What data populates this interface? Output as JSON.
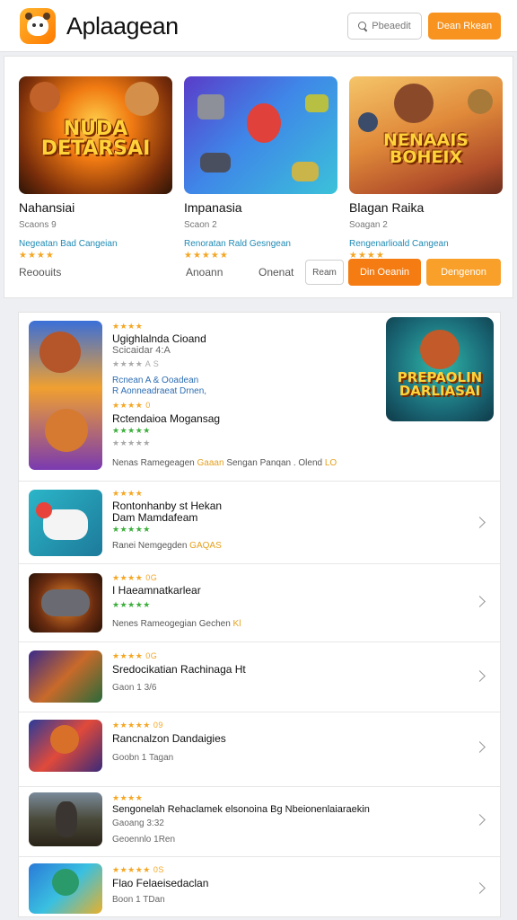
{
  "header": {
    "app_title": "Aplaagean",
    "search_label": "Pbeaedit",
    "signin_label": "Dean Rkean"
  },
  "featured": {
    "cards": [
      {
        "banner": "NUDA DETARSAI",
        "name": "Nahansiai",
        "meta": "Scaons 9",
        "category": "Negeatan Bad Cangeian",
        "stars": "★★★★"
      },
      {
        "banner": "",
        "name": "Impanasia",
        "meta": "Scaon 2",
        "category": "Renoratan Rald Gesngean",
        "stars": "★★★★★"
      },
      {
        "banner": "NENAAIS BOHEIX",
        "name": "Blagan Raika",
        "meta": "Soagan 2",
        "category": "Rengenarlioald Cangean",
        "stars": "★★★★"
      }
    ],
    "links": [
      "Reoouits",
      "Anoann",
      "Onenat"
    ],
    "outline_button": "Ream",
    "orange_button_1": "Din Oeanin",
    "orange_button_2": "Dengenon"
  },
  "list": {
    "first": {
      "stars_top": "★★★★",
      "title": "Ugighlalnda Cioand",
      "sub": "Scicaidar 4:A",
      "graystars": "★★★★ A S",
      "link1": "Rcnean A & Ooadean",
      "link2": "R Aonneadraeat Drnen,",
      "stars2": "★★★★ 0",
      "title2": "Rctendaioa Mogansag",
      "gstars": "★★★★★",
      "graystars2": "★★★★★",
      "meta": "Nenas Ramegeagen",
      "meta_accent": "Gaaan",
      "meta_rest": "Sengan Panqan . Olend",
      "meta_end": "LO",
      "side_banner": "PREPAOLIN DARLIASAI"
    },
    "rows": [
      {
        "stars": "★★★★",
        "title": "Rontonhanby st Hekan",
        "sub": "Dam Mamdafeam",
        "gstars": "★★★★★",
        "meta": "Ranei Nemgegden",
        "accent": "GAQAS"
      },
      {
        "stars": "★★★★ 0G",
        "title": "I Haeamnatkarlear",
        "gstars": "★★★★★",
        "meta": "Nenes Rameogegian Gechen",
        "accent": "Kl"
      },
      {
        "stars": "★★★★ 0G",
        "title": "Sredocikatian Rachinaga Ht",
        "meta": "Gaon 1 3/6",
        "accent": ""
      },
      {
        "stars": "★★★★★ 09",
        "title": "Rancnalzon Dandaigies",
        "meta": "Goobn 1 Tagan",
        "accent": ""
      },
      {
        "stars": "★★★★",
        "title": "Sengonelah Rehaclamek elsonoina Bg Nbeionenlaiaraekin",
        "meta": "Gaoang 3:32",
        "meta2": "Geoennlo 1Ren",
        "accent": ""
      },
      {
        "stars": "★★★★★ 0S",
        "title": "Flao Felaeisedaclan",
        "meta": "Boon 1 TDan",
        "accent": ""
      }
    ]
  },
  "colors": {
    "accent": "#f7931e",
    "link": "#1e8ab5",
    "star": "#f5a623",
    "green_star": "#3cae3c"
  }
}
